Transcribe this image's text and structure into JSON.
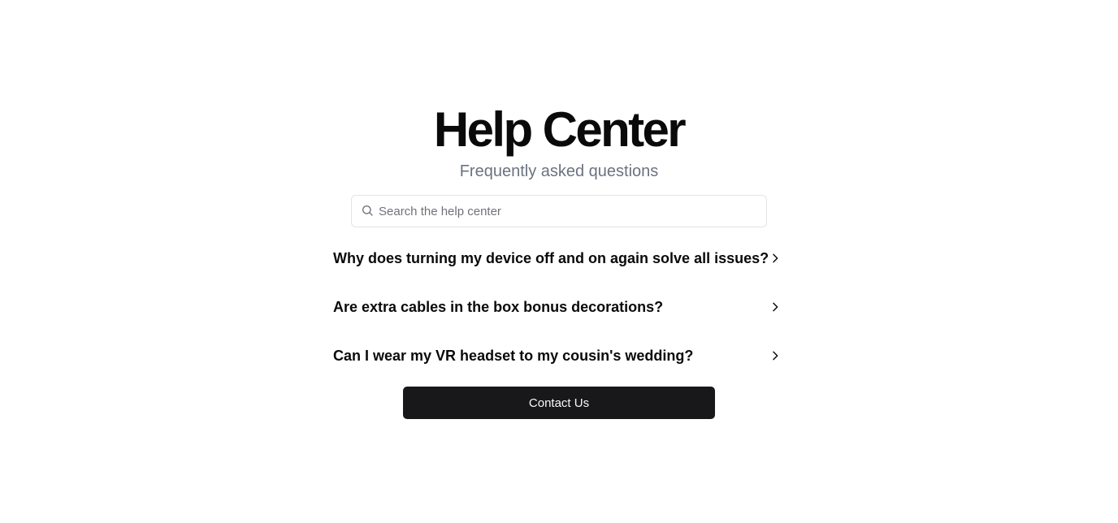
{
  "header": {
    "title": "Help Center",
    "subtitle": "Frequently asked questions"
  },
  "search": {
    "placeholder": "Search the help center",
    "value": "",
    "icon": "search-icon"
  },
  "faq": {
    "items": [
      {
        "question": "Why does turning my device off and on again solve all issues?",
        "icon": "chevron-right-icon"
      },
      {
        "question": "Are extra cables in the box bonus decorations?",
        "icon": "chevron-right-icon"
      },
      {
        "question": "Can I wear my VR headset to my cousin's wedding?",
        "icon": "chevron-right-icon"
      }
    ]
  },
  "actions": {
    "contact_label": "Contact Us"
  },
  "colors": {
    "background": "#ffffff",
    "text": "#0a0a0a",
    "muted": "#6b7280",
    "border": "#e4e4e7",
    "button_bg": "#18181b",
    "button_text": "#fafafa"
  }
}
